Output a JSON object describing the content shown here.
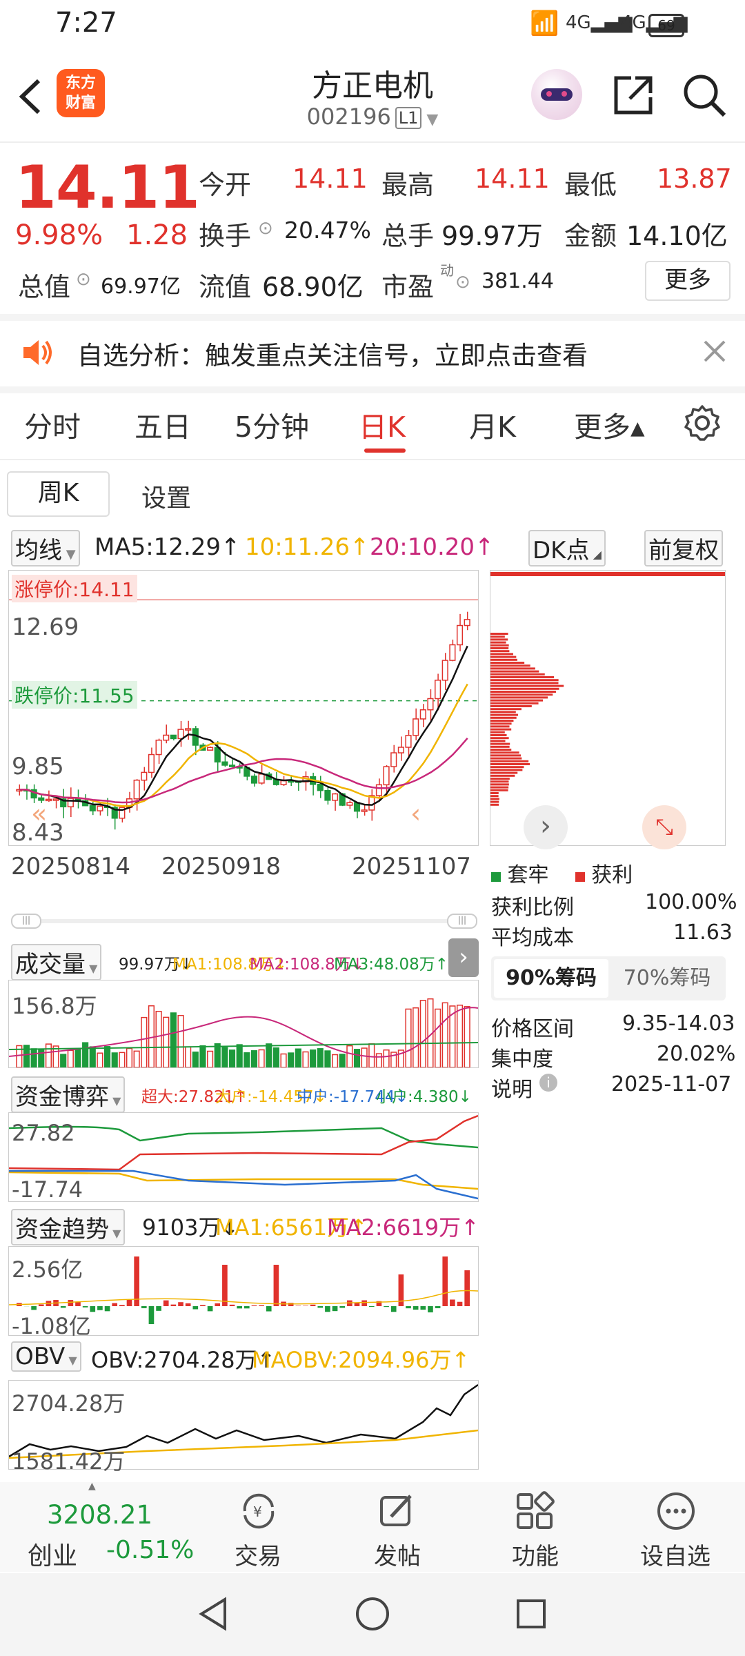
{
  "status_bar": {
    "time": "7:27",
    "battery": "69"
  },
  "header": {
    "brand": {
      "line1": "东方",
      "line2": "财富"
    },
    "stock_name": "方正电机",
    "stock_code": "002196",
    "level_badge": "L1"
  },
  "quote": {
    "price": "14.11",
    "change_pct": "9.98%",
    "change": "1.28",
    "open_label": "今开",
    "open": "14.11",
    "high_label": "最高",
    "high": "14.11",
    "low_label": "最低",
    "low": "13.87",
    "turnover_label": "换手",
    "turnover": "20.47%",
    "volume_label": "总手",
    "volume": "99.97万",
    "amount_label": "金额",
    "amount": "14.10亿",
    "mktcap_label": "总值",
    "mktcap": "69.97亿",
    "float_label": "流值",
    "float_value": "68.90亿",
    "pe_label": "市盈",
    "pe_sup": "动",
    "pe": "381.44",
    "more_label": "更多"
  },
  "banner": {
    "text": "自选分析：触发重点关注信号，立即点击查看"
  },
  "tabs": [
    "分时",
    "五日",
    "5分钟",
    "日K",
    "月K",
    "更多▴"
  ],
  "active_tab": "日K",
  "subtabs": {
    "week": "周K",
    "settings": "设置"
  },
  "kline": {
    "ma_btn": "均线",
    "ma5": "MA5:12.29↑",
    "ma10": "10:11.26↑",
    "ma20": "20:10.20↑",
    "dk_btn": "DK点",
    "fq_btn": "前复权",
    "limit_up": "涨停价:14.11",
    "limit_down": "跌停价:11.55",
    "y_labels": [
      "12.69",
      "9.85",
      "8.43"
    ],
    "x_labels": [
      "20250814",
      "20250918",
      "20251107"
    ],
    "colors": {
      "up": "#e0322c",
      "down": "#1d9a3c",
      "ma5": "#111111",
      "ma10": "#f0b400",
      "ma20": "#c8287a"
    }
  },
  "volume": {
    "label": "成交量",
    "val": "99.97万↓",
    "ma1": "MA1:108.8万↓",
    "ma2": "MA2:108.8万↓",
    "ma3": "MA3:48.08万↑",
    "ylabel": "156.8万"
  },
  "fund_game": {
    "label": "资金博弈",
    "super": "超大:27.821↑",
    "big": "大户:-14.457↓",
    "mid": "中户:-17.744↓",
    "small": "小户:4.380↓",
    "ymax": "27.82",
    "ymin": "-17.74"
  },
  "fund_trend": {
    "label": "资金趋势",
    "val": "9103万↓",
    "ma1": "MA1:6561万↑",
    "ma2": "MA2:6619万↑",
    "ymax": "2.56亿",
    "ymin": "-1.08亿"
  },
  "obv": {
    "label": "OBV",
    "val": "OBV:2704.28万↑",
    "maobv": "MAOBV:2094.96万↑",
    "ymax": "2704.28万",
    "ymin": "1581.42万"
  },
  "chip": {
    "legend_trap": "套牢",
    "legend_profit": "获利",
    "profit_ratio_label": "获利比例",
    "profit_ratio": "100.00%",
    "avg_cost_label": "平均成本",
    "avg_cost": "11.63",
    "tab90": "90%筹码",
    "tab70": "70%筹码",
    "range_label": "价格区间",
    "range": "9.35-14.03",
    "conc_label": "集中度",
    "conc": "20.02%",
    "note_label": "说明",
    "note_date": "2025-11-07"
  },
  "bottom_nav": {
    "index_value": "3208.21",
    "index_name": "创业",
    "index_pct": "-0.51%",
    "trade": "交易",
    "post": "发帖",
    "function": "功能",
    "add_fav": "设自选"
  }
}
